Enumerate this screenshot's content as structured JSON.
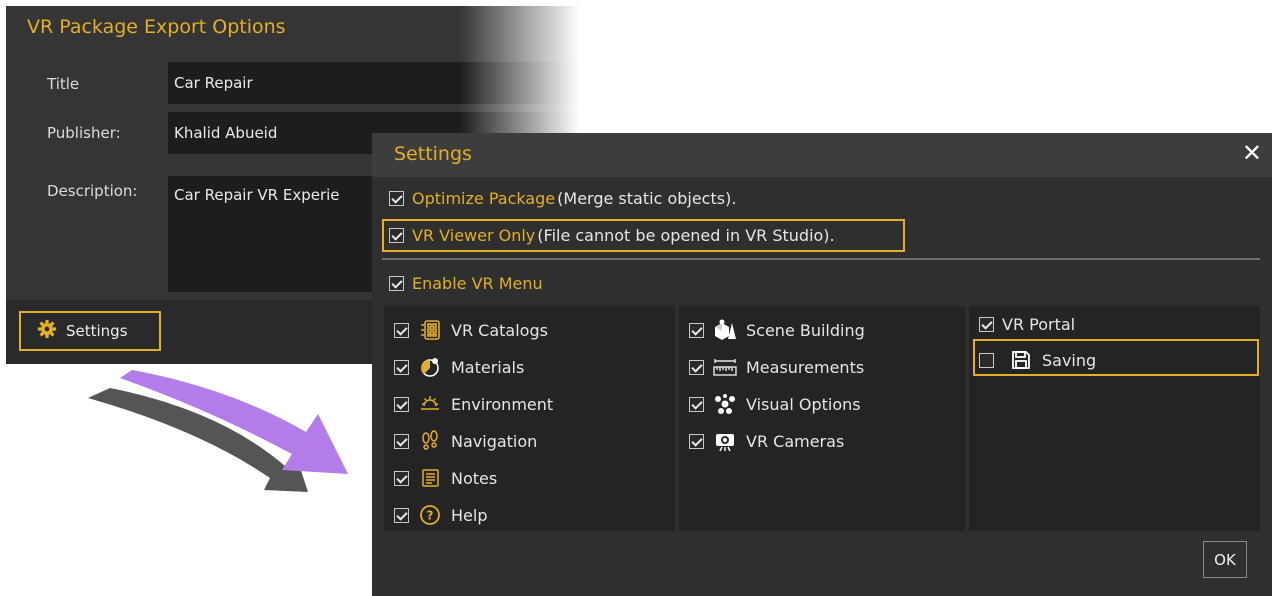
{
  "export_window": {
    "title": "VR Package Export Options",
    "fields": {
      "title_label": "Title",
      "title_value": "Car Repair",
      "publisher_label": "Publisher:",
      "publisher_value": "Khalid Abueid",
      "description_label": "Description:",
      "description_value": "Car Repair VR Experie"
    },
    "settings_button": "Settings"
  },
  "settings": {
    "title": "Settings",
    "close_label": "✕",
    "optimize": {
      "label": "Optimize Package",
      "note": "(Merge static objects).",
      "checked": true
    },
    "viewer_only": {
      "label": "VR Viewer Only",
      "note": "(File cannot be opened in VR Studio).",
      "checked": true,
      "highlighted": true
    },
    "enable_menu": {
      "label": "Enable VR Menu",
      "checked": true
    },
    "menu_col1": [
      {
        "label": "VR Catalogs",
        "icon": "catalog-grid-icon",
        "checked": true
      },
      {
        "label": "Materials",
        "icon": "materials-sphere-icon",
        "checked": true
      },
      {
        "label": "Environment",
        "icon": "sun-icon",
        "checked": true
      },
      {
        "label": "Navigation",
        "icon": "footprints-icon",
        "checked": true
      },
      {
        "label": "Notes",
        "icon": "notes-icon",
        "checked": true
      },
      {
        "label": "Help",
        "icon": "help-circle-icon",
        "checked": true
      }
    ],
    "menu_col2": [
      {
        "label": "Scene Building",
        "icon": "shapes-icon",
        "checked": true
      },
      {
        "label": "Measurements",
        "icon": "ruler-icon",
        "checked": true
      },
      {
        "label": "Visual Options",
        "icon": "visual-options-icon",
        "checked": true
      },
      {
        "label": "VR Cameras",
        "icon": "camera-icon",
        "checked": true
      }
    ],
    "menu_col3": [
      {
        "label": "VR Portal",
        "checked": true
      },
      {
        "label": "Saving",
        "icon": "floppy-disk-icon",
        "checked": false,
        "highlighted": true
      }
    ],
    "ok_label": "OK"
  },
  "colors": {
    "accent": "#e3ae28",
    "arrow_front": "#b37ce8",
    "arrow_back": "#555555"
  }
}
